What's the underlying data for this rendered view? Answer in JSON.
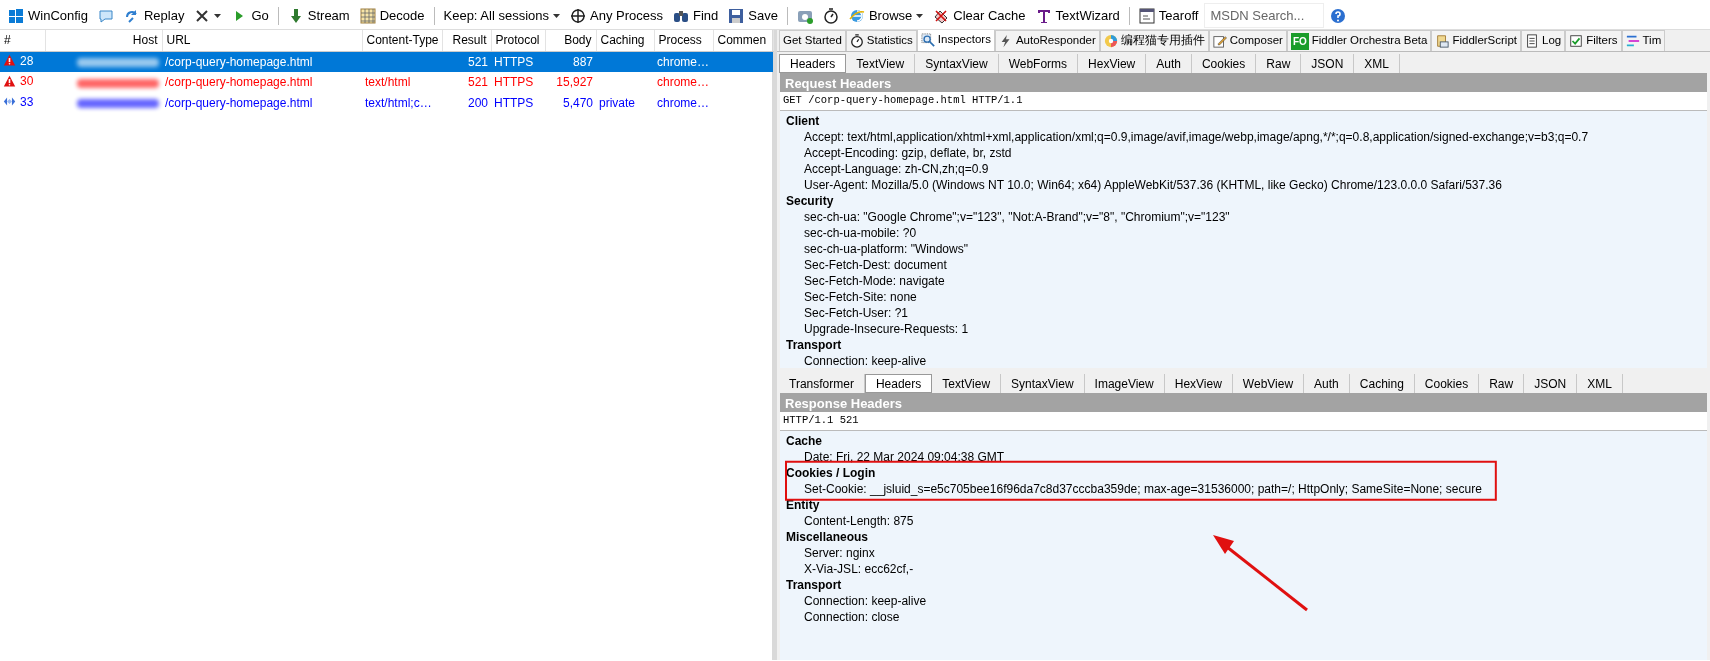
{
  "toolbar": [
    {
      "kind": "windows",
      "label": "WinConfig"
    },
    {
      "kind": "comment"
    },
    {
      "kind": "replay",
      "label": "Replay"
    },
    {
      "kind": "remove",
      "dropdown": true
    },
    {
      "kind": "go",
      "label": "Go"
    },
    {
      "kind": "separator"
    },
    {
      "kind": "stream",
      "label": "Stream"
    },
    {
      "kind": "decode",
      "label": "Decode"
    },
    {
      "kind": "separator"
    },
    {
      "kind": "text",
      "label": "Keep: All sessions",
      "dropdown": true
    },
    {
      "kind": "process",
      "label": "Any Process"
    },
    {
      "kind": "find",
      "label": "Find"
    },
    {
      "kind": "save",
      "label": "Save"
    },
    {
      "kind": "separator"
    },
    {
      "kind": "camera"
    },
    {
      "kind": "timer"
    },
    {
      "kind": "browse",
      "label": "Browse",
      "dropdown": true
    },
    {
      "kind": "clear",
      "label": "Clear Cache"
    },
    {
      "kind": "textwizard",
      "label": "TextWizard"
    },
    {
      "kind": "separator"
    },
    {
      "kind": "tearoff",
      "label": "Tearoff"
    },
    {
      "kind": "search",
      "placeholder": "MSDN Search..."
    },
    {
      "kind": "help"
    }
  ],
  "sessions": {
    "columns": [
      "#",
      "Host",
      "URL",
      "Content-Type",
      "Result",
      "Protocol",
      "Body",
      "Caching",
      "Process",
      "Commen"
    ],
    "rows": [
      {
        "kind": "error",
        "id": "28",
        "host_redacted": true,
        "url": "/corp-query-homepage.html",
        "result": "521",
        "protocol": "HTTPS",
        "body": "887",
        "process": "chrome…",
        "selected": true
      },
      {
        "kind": "error",
        "id": "30",
        "host_redacted": true,
        "url": "/corp-query-homepage.html",
        "content_type": "text/html",
        "result": "521",
        "protocol": "HTTPS",
        "body": "15,927",
        "process": "chrome…",
        "selected": false,
        "color": "#ff0000"
      },
      {
        "kind": "stream",
        "id": "33",
        "host_redacted": true,
        "url": "/corp-query-homepage.html",
        "content_type": "text/html;c…",
        "result": "200",
        "protocol": "HTTPS",
        "body": "5,470",
        "caching": "private",
        "process": "chrome…",
        "selected": false,
        "color": "#0000ff"
      }
    ]
  },
  "tabs": [
    {
      "kind": "plain",
      "label": "Get Started",
      "selected": false
    },
    {
      "kind": "timer",
      "label": "Statistics",
      "selected": false
    },
    {
      "kind": "inspect",
      "label": "Inspectors",
      "selected": true
    },
    {
      "kind": "bolt",
      "label": "AutoResponder",
      "selected": false
    },
    {
      "kind": "plugin",
      "label": "编程猫专用插件",
      "selected": false
    },
    {
      "kind": "composer",
      "label": "Composer",
      "selected": false
    },
    {
      "kind": "badge",
      "badge": "FO",
      "label": "Fiddler Orchestra Beta",
      "selected": false
    },
    {
      "kind": "script",
      "label": "FiddlerScript",
      "selected": false
    },
    {
      "kind": "log",
      "label": "Log",
      "selected": false
    },
    {
      "kind": "filters",
      "label": "Filters",
      "selected": false
    },
    {
      "kind": "timeline",
      "label": "Tim",
      "selected": false
    }
  ],
  "request": {
    "tabs": [
      {
        "label": "Headers",
        "selected": true
      },
      {
        "label": "TextView",
        "selected": false
      },
      {
        "label": "SyntaxView",
        "selected": false
      },
      {
        "label": "WebForms",
        "selected": false
      },
      {
        "label": "HexView",
        "selected": false
      },
      {
        "label": "Auth",
        "selected": false
      },
      {
        "label": "Cookies",
        "selected": false
      },
      {
        "label": "Raw",
        "selected": false
      },
      {
        "label": "JSON",
        "selected": false
      },
      {
        "label": "XML",
        "selected": false
      }
    ],
    "title": "Request Headers",
    "first_line": "GET /corp-query-homepage.html HTTP/1.1",
    "groups": [
      {
        "name": "Client",
        "headers": [
          "Accept: text/html,application/xhtml+xml,application/xml;q=0.9,image/avif,image/webp,image/apng,*/*;q=0.8,application/signed-exchange;v=b3;q=0.7",
          "Accept-Encoding: gzip, deflate, br, zstd",
          "Accept-Language: zh-CN,zh;q=0.9",
          "User-Agent: Mozilla/5.0 (Windows NT 10.0; Win64; x64) AppleWebKit/537.36 (KHTML, like Gecko) Chrome/123.0.0.0 Safari/537.36"
        ]
      },
      {
        "name": "Security",
        "headers": [
          "sec-ch-ua: \"Google Chrome\";v=\"123\", \"Not:A-Brand\";v=\"8\", \"Chromium\";v=\"123\"",
          "sec-ch-ua-mobile: ?0",
          "sec-ch-ua-platform: \"Windows\"",
          "Sec-Fetch-Dest: document",
          "Sec-Fetch-Mode: navigate",
          "Sec-Fetch-Site: none",
          "Sec-Fetch-User: ?1",
          "Upgrade-Insecure-Requests: 1"
        ]
      },
      {
        "name": "Transport",
        "headers": [
          "Connection: keep-alive"
        ]
      }
    ]
  },
  "response": {
    "tabs": [
      {
        "label": "Transformer",
        "selected": false
      },
      {
        "label": "Headers",
        "selected": true
      },
      {
        "label": "TextView",
        "selected": false
      },
      {
        "label": "SyntaxView",
        "selected": false
      },
      {
        "label": "ImageView",
        "selected": false
      },
      {
        "label": "HexView",
        "selected": false
      },
      {
        "label": "WebView",
        "selected": false
      },
      {
        "label": "Auth",
        "selected": false
      },
      {
        "label": "Caching",
        "selected": false
      },
      {
        "label": "Cookies",
        "selected": false
      },
      {
        "label": "Raw",
        "selected": false
      },
      {
        "label": "JSON",
        "selected": false
      },
      {
        "label": "XML",
        "selected": false
      }
    ],
    "title": "Response Headers",
    "first_line": "HTTP/1.1 521",
    "groups": [
      {
        "name": "Cache",
        "headers": [
          "Date: Fri, 22 Mar 2024 09:04:38 GMT"
        ]
      },
      {
        "name": "Cookies / Login",
        "headers": [
          "Set-Cookie: __jsluid_s=e5c705bee16f96da7c8d37cccba359de; max-age=31536000; path=/; HttpOnly; SameSite=None; secure"
        ]
      },
      {
        "name": "Entity",
        "headers": [
          "Content-Length: 875"
        ]
      },
      {
        "name": "Miscellaneous",
        "headers": [
          "Server: nginx",
          "X-Via-JSL: ecc62cf,-"
        ]
      },
      {
        "name": "Transport",
        "headers": [
          "Connection: keep-alive",
          "Connection: close"
        ]
      }
    ]
  },
  "annotation": {
    "highlight_box": true,
    "arrow": true
  }
}
